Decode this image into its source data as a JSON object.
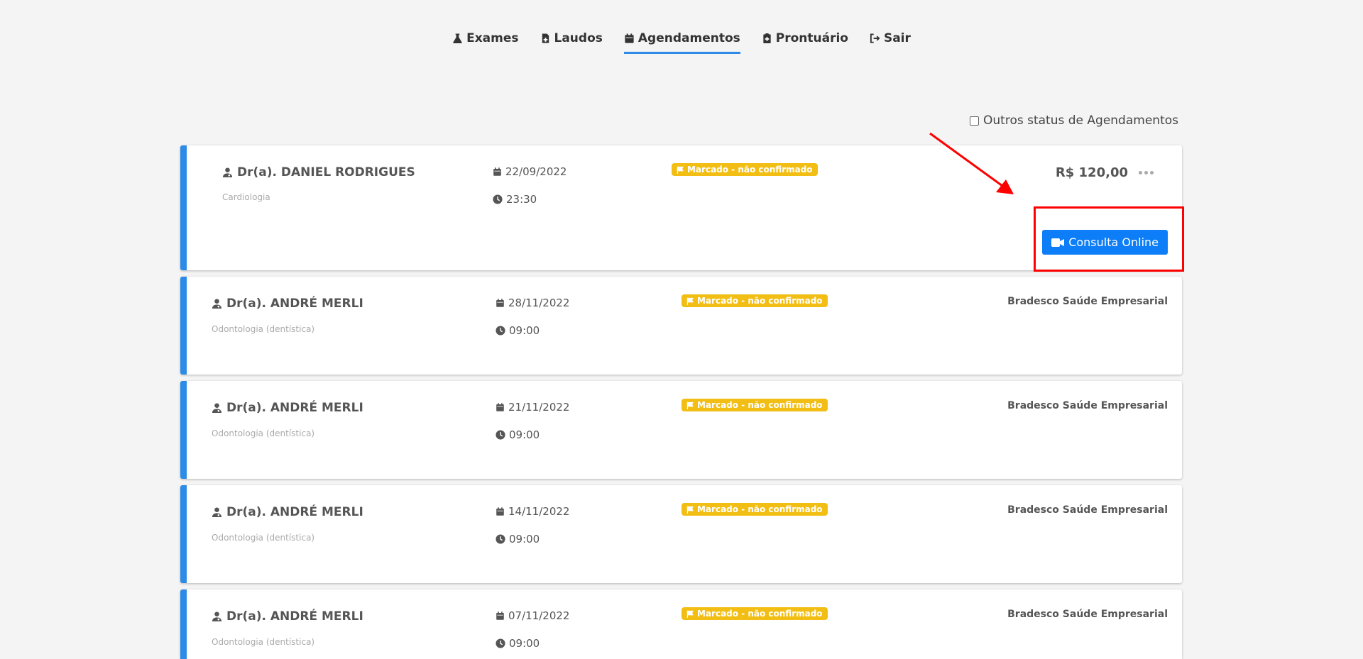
{
  "nav": {
    "items": [
      {
        "label": "Exames",
        "icon": "flask-icon",
        "active": false
      },
      {
        "label": "Laudos",
        "icon": "file-medical-icon",
        "active": false
      },
      {
        "label": "Agendamentos",
        "icon": "calendar-icon",
        "active": true
      },
      {
        "label": "Prontuário",
        "icon": "clipboard-medical-icon",
        "active": false
      },
      {
        "label": "Sair",
        "icon": "sign-out-icon",
        "active": false
      }
    ]
  },
  "filter": {
    "label": "Outros status de Agendamentos",
    "checked": false
  },
  "appointments": [
    {
      "doctor": "Dr(a). DANIEL RODRIGUES",
      "specialty": "Cardiologia",
      "date": "22/09/2022",
      "time": "23:30",
      "status": "Marcado - não confirmado",
      "price": "R$ 120,00",
      "button_label": "Consulta Online"
    },
    {
      "doctor": "Dr(a). ANDRÉ MERLI",
      "specialty": "Odontologia (dentística)",
      "date": "28/11/2022",
      "time": "09:00",
      "status": "Marcado - não confirmado",
      "insurance": "Bradesco Saúde Empresarial"
    },
    {
      "doctor": "Dr(a). ANDRÉ MERLI",
      "specialty": "Odontologia (dentística)",
      "date": "21/11/2022",
      "time": "09:00",
      "status": "Marcado - não confirmado",
      "insurance": "Bradesco Saúde Empresarial"
    },
    {
      "doctor": "Dr(a). ANDRÉ MERLI",
      "specialty": "Odontologia (dentística)",
      "date": "14/11/2022",
      "time": "09:00",
      "status": "Marcado - não confirmado",
      "insurance": "Bradesco Saúde Empresarial"
    },
    {
      "doctor": "Dr(a). ANDRÉ MERLI",
      "specialty": "Odontologia (dentística)",
      "date": "07/11/2022",
      "time": "09:00",
      "status": "Marcado - não confirmado",
      "insurance": "Bradesco Saúde Empresarial"
    }
  ],
  "colors": {
    "accent": "#2b8be6",
    "badge": "#f2be14",
    "button": "#0d7ef7",
    "annotation": "#ff0000"
  }
}
